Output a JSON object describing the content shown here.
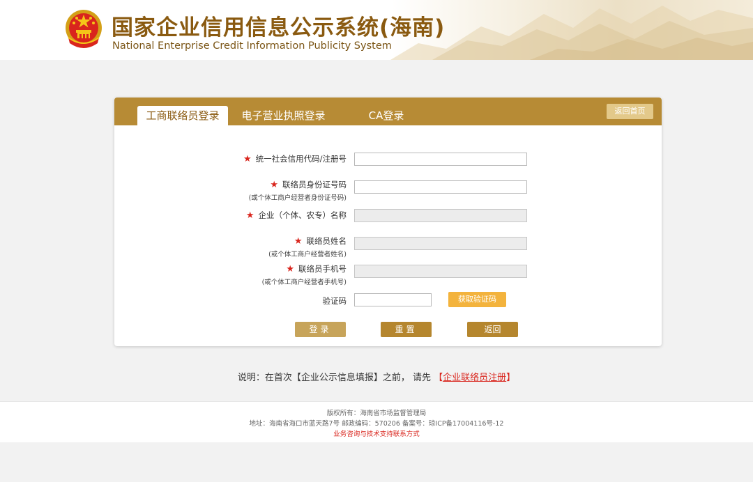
{
  "header": {
    "title_cn": "国家企业信用信息公示系统(海南)",
    "title_en": "National Enterprise Credit Information Publicity System"
  },
  "tabs": [
    {
      "label": "工商联络员登录",
      "active": true
    },
    {
      "label": "电子营业执照登录",
      "active": false
    },
    {
      "label": "CA登录",
      "active": false
    }
  ],
  "back_home_label": "返回首页",
  "form": {
    "credit_code_label": "统一社会信用代码/注册号",
    "id_label": "联络员身份证号码",
    "id_sub": "(或个体工商户经营者身份证号码)",
    "company_label": "企业（个体、农专）名称",
    "name_label": "联络员姓名",
    "name_sub": "(或个体工商户经营者姓名)",
    "phone_label": "联络员手机号",
    "phone_sub": "(或个体工商户经营者手机号)",
    "captcha_label": "验证码",
    "credit_code_value": "",
    "id_value": "",
    "company_value": "",
    "name_value": "",
    "phone_value": "",
    "captcha_value": "",
    "get_code_label": "获取验证码",
    "star": "★"
  },
  "buttons": {
    "login": "登录",
    "reset": "重置",
    "back": "返回"
  },
  "note": {
    "text": "说明：在首次【企业公示信息填报】之前，  请先",
    "link_open": "【",
    "link": "企业联络员注册",
    "link_close": "】"
  },
  "footer": {
    "copyright": "版权所有：海南省市场监督管理局",
    "address": "地址：海南省海口市蓝天路7号 邮政编码：570206 备案号：琼ICP备17004116号-12",
    "support": "业务咨询与技术支持联系方式"
  },
  "colors": {
    "brand_gold": "#b78b35",
    "title_brown": "#8a5a10",
    "required_red": "#d9251d",
    "code_button": "#f3b33d"
  }
}
